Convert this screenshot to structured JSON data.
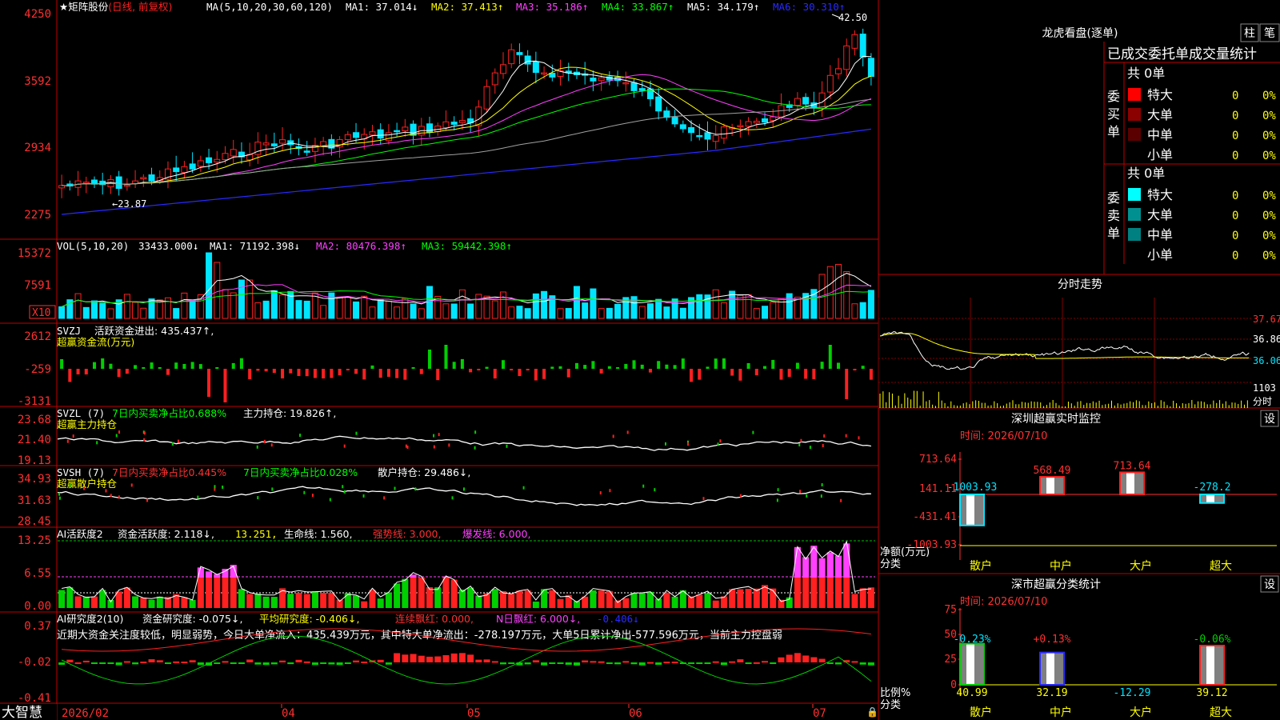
{
  "app": {
    "name": "大智慧"
  },
  "colors": {
    "up": "#ff2020",
    "down": "#00e5ff",
    "bg": "#000000",
    "frame": "#c00000",
    "ma1": "#ffffff",
    "ma2": "#ffff00",
    "ma3": "#ff40ff",
    "ma4": "#00ff00",
    "ma5": "#a0a0a0",
    "ma6": "#2a2aff"
  },
  "price_panel": {
    "title_star": "★矩阵股份",
    "mode": "(日线, 前复权)",
    "ma_params": "MA(5,10,20,30,60,120)",
    "ma_labels": [
      "MA1: 37.014↓",
      "MA2: 37.413↑",
      "MA3: 35.186↑",
      "MA4: 33.867↑",
      "MA5: 34.179↑",
      "MA6: 30.310↑"
    ],
    "y_ticks": [
      "4250",
      "3592",
      "2934",
      "2275"
    ],
    "high_label": "42.50",
    "low_label": "←23.87"
  },
  "vol_panel": {
    "title": "VOL(5,10,20)",
    "vol": "33433.000↓",
    "ma1": "MA1: 71192.398↓",
    "ma2": "MA2: 80476.398↑",
    "ma3": "MA3: 59442.398↑",
    "y_ticks": [
      "15372",
      "7591"
    ],
    "unit": "X10"
  },
  "svzj_panel": {
    "title": "SVZJ",
    "label": "活跃资金进出: 435.437↑,",
    "sub": "超赢资金流(万元)",
    "y_ticks": [
      "2612",
      "-259",
      "-3131"
    ]
  },
  "svzl_panel": {
    "title": "SVZL (7)",
    "label1": "7日内买卖净占比0.688%",
    "label2": "主力持仓: 19.826↑,",
    "sub": "超赢主力持仓",
    "y_ticks": [
      "23.68",
      "21.40",
      "19.13"
    ]
  },
  "svsh_panel": {
    "title": "SVSH (7)",
    "label1": "7日内买卖净占比0.445%",
    "label2": "7日内买卖净占比0.028%",
    "label3": "散户持仓: 29.486↓,",
    "sub": "超赢散户持仓",
    "y_ticks": [
      "34.93",
      "31.63",
      "28.45"
    ]
  },
  "ai_act_panel": {
    "title": "AI活跃度2",
    "label1": "资金活跃度: 2.118↓,",
    "label2": "13.251,",
    "label3": "生命线: 1.560,",
    "label4": "强势线: 3.000,",
    "label5": "爆发线: 6.000,",
    "y_ticks": [
      "13.25",
      "6.55",
      "0.00"
    ]
  },
  "ai_res_panel": {
    "title": "AI研究度2(10)",
    "label1": "资金研究度: -0.075↓,",
    "label2": "平均研究度: -0.406↓,",
    "label3": "连续飘红: 0.000,",
    "label4": "N日飘红: 6.000↓,",
    "label5": "-0.406↓",
    "comment": "近期大资金关注度较低，明显弱势，今日大单净流入：435.439万元，其中特大单净流出：-278.197万元，大单5日累计净出-577.596万元，当前主力控盘弱",
    "y_ticks": [
      "0.37",
      "-0.02",
      "-0.41"
    ]
  },
  "x_axis": {
    "labels": [
      "2026/02",
      "04",
      "05",
      "06",
      "07"
    ]
  },
  "chart_data": [
    {
      "type": "candlestick",
      "title": "★矩阵股份 (日线, 前复权)",
      "ylim": [
        2275,
        4250
      ],
      "note": "Price values as displayed by the tick labels",
      "ma_series": [
        {
          "name": "MA1",
          "last": 37.014
        },
        {
          "name": "MA2",
          "last": 37.413
        },
        {
          "name": "MA3",
          "last": 35.186
        },
        {
          "name": "MA4",
          "last": 33.867
        },
        {
          "name": "MA5",
          "last": 34.179
        },
        {
          "name": "MA6",
          "last": 30.31
        }
      ],
      "high": 42.5,
      "low": 23.87
    },
    {
      "type": "bar",
      "title": "VOL(5,10,20)",
      "ylim": [
        0,
        15372
      ],
      "series": [
        {
          "name": "VOL",
          "last": 33433.0
        },
        {
          "name": "MA1",
          "last": 71192.398
        },
        {
          "name": "MA2",
          "last": 80476.398
        },
        {
          "name": "MA3",
          "last": 59442.398
        }
      ]
    },
    {
      "type": "bar",
      "title": "SVZJ 超赢资金流(万元)",
      "ylim": [
        -3131,
        2612
      ],
      "series": [
        {
          "name": "活跃资金进出",
          "last": 435.437
        }
      ]
    },
    {
      "type": "line",
      "title": "SVZL (7) 超赢主力持仓",
      "ylim": [
        19.13,
        23.68
      ],
      "series": [
        {
          "name": "主力持仓",
          "last": 19.826
        }
      ]
    },
    {
      "type": "line",
      "title": "SVSH (7) 超赢散户持仓",
      "ylim": [
        28.45,
        34.93
      ],
      "series": [
        {
          "name": "散户持仓",
          "last": 29.486
        }
      ]
    },
    {
      "type": "bar",
      "title": "AI活跃度2",
      "ylim": [
        0,
        13.25
      ],
      "series": [
        {
          "name": "资金活跃度",
          "last": 2.118
        },
        {
          "name": "生命线",
          "last": 1.56
        },
        {
          "name": "强势线",
          "last": 3.0
        },
        {
          "name": "爆发线",
          "last": 6.0
        }
      ]
    },
    {
      "type": "bar",
      "title": "AI研究度2(10)",
      "ylim": [
        -0.41,
        0.37
      ],
      "series": [
        {
          "name": "资金研究度",
          "last": -0.075
        },
        {
          "name": "平均研究度",
          "last": -0.406
        }
      ]
    },
    {
      "type": "table",
      "title": "龙虎看盘(逐单)",
      "header": [
        "已成交",
        "委托单",
        "成交量统计"
      ],
      "buy": {
        "label": "委买单",
        "total": "共 0单",
        "rows": [
          [
            "特大",
            "0",
            "0%"
          ],
          [
            "大单",
            "0",
            "0%"
          ],
          [
            "中单",
            "0",
            "0%"
          ],
          [
            "小单",
            "0",
            "0%"
          ]
        ]
      },
      "sell": {
        "label": "委卖单",
        "total": "共 0单",
        "rows": [
          [
            "特大",
            "0",
            "0%"
          ],
          [
            "大单",
            "0",
            "0%"
          ],
          [
            "中单",
            "0",
            "0%"
          ],
          [
            "小单",
            "0",
            "0%"
          ]
        ]
      }
    },
    {
      "type": "line",
      "title": "分时走势",
      "y_ticks": [
        "37.67",
        "36.86",
        "36.06"
      ],
      "vol_tick": "1103",
      "vol_label": "分时"
    },
    {
      "type": "bar",
      "title": "深圳超赢实时监控",
      "time": "时间: 2026/07/10",
      "ylabel": "净额(万元)",
      "xlabel": "分类",
      "categories": [
        "散户",
        "中户",
        "大户",
        "超大"
      ],
      "values": [
        -1003.93,
        568.49,
        713.64,
        -278.2
      ],
      "y_ticks": [
        "713.64",
        "141.11",
        "-431.41",
        "-1003.93"
      ]
    },
    {
      "type": "bar",
      "title": "深市超赢分类统计",
      "time": "时间: 2026/07/10",
      "ylabel": "比例%",
      "xlabel": "分类",
      "categories": [
        "散户",
        "中户",
        "大户",
        "超大"
      ],
      "values": [
        40.99,
        32.19,
        -12.29,
        39.12
      ],
      "change_labels": [
        "-0.23%",
        "+0.13%",
        "",
        "-0.06%"
      ],
      "y_ticks": [
        "75",
        "50",
        "25",
        "0"
      ]
    }
  ],
  "right_panel": {
    "lhkp_title": "龙虎看盘(逐单)",
    "btn_col": "柱",
    "btn_pen": "笔",
    "header": "已成交委托单成交量统计",
    "buy_label": [
      "委",
      "买",
      "单"
    ],
    "sell_label": [
      "委",
      "卖",
      "单"
    ],
    "buy_total": "共 0单",
    "sell_total": "共 0单",
    "rows": [
      "特大",
      "大单",
      "中单",
      "小单"
    ],
    "zero": "0",
    "zero_pct": "0%",
    "fs_title": "分时走势",
    "fs_ticks": [
      "37.67",
      "36.86",
      "36.06"
    ],
    "fs_vol": "1103",
    "fs_vol_label": "分时",
    "rt_title": "深圳超赢实时监控",
    "rt_time": "时间: 2026/07/10",
    "rt_settings": "设",
    "rt_ticks": [
      "713.64",
      "141.11",
      "-431.41",
      "-1003.93"
    ],
    "rt_ylabel": "净额(万元)",
    "rt_xlabel": "分类",
    "rt_values": [
      "-1003.93",
      "568.49",
      "713.64",
      "-278.2"
    ],
    "cls_title": "深市超赢分类统计",
    "cls_time": "时间: 2026/07/10",
    "cls_settings": "设",
    "cls_ticks": [
      "75",
      "50",
      "25",
      "0"
    ],
    "cls_ylabel": "比例%",
    "cls_xlabel": "分类",
    "cls_values": [
      "40.99",
      "32.19",
      "-12.29",
      "39.12"
    ],
    "cls_changes": [
      "-0.23%",
      "+0.13%",
      "-0.06%"
    ],
    "categories": [
      "散户",
      "中户",
      "大户",
      "超大"
    ]
  }
}
